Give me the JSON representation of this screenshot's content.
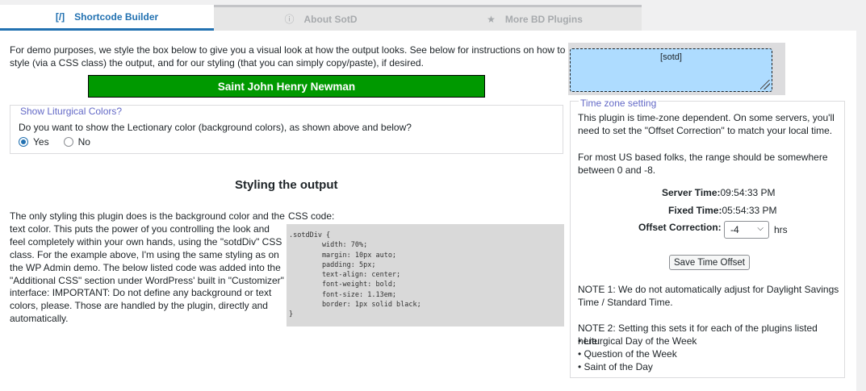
{
  "tabs": [
    {
      "label": "Shortcode Builder",
      "icon": "[/]",
      "active": true
    },
    {
      "label": "About SotD",
      "icon": "ⓘ",
      "active": false
    },
    {
      "label": "More BD Plugins",
      "icon": "★",
      "active": false
    }
  ],
  "intro": "For demo purposes, we style the box below to give you a visual look at how the output looks. See below for instructions on how to style (via a CSS class) the output, and for our styling (that you can simply copy/paste), if desired.",
  "demo_box": {
    "text": "Saint John Henry Newman",
    "bg_color": "#009900"
  },
  "liturgical": {
    "legend": "Show Liturgical Colors?",
    "question": "Do you want to show the Lectionary color (background colors), as shown above and below?",
    "options": [
      "Yes",
      "No"
    ],
    "selected": "Yes"
  },
  "styling": {
    "title": "Styling the output",
    "body": "The only styling this plugin does is the background color and the text color. This puts the power of you controlling the look and feel completely within your own hands, using the \"sotdDiv\" CSS class. For the example above, I'm using the same styling as on the WP Admin demo. The below listed code was added into the \"Additional CSS\" section under WordPress' built in \"Customizer\" interface: IMPORTANT: Do not define any background or text colors, please. Those are handled by the plugin, directly and automatically.",
    "css_label": "CSS code:",
    "css_code": ".sotdDiv {\n        width: 70%;\n        margin: 10px auto;\n        padding: 5px;\n        text-align: center;\n        font-weight: bold;\n        font-size: 1.13em;\n        border: 1px solid black;\n}"
  },
  "shortcode": {
    "value": "[sotd]"
  },
  "timezone": {
    "legend": "Time zone setting",
    "para1": "This plugin is time-zone dependent. On some servers, you'll need to set the \"Offset Correction\" to match your local time.",
    "para2": "For most US based folks, the range should be somewhere between 0 and -8.",
    "server_time_label": "Server Time:",
    "server_time": "09:54:33 PM",
    "fixed_time_label": "Fixed Time:",
    "fixed_time": "05:54:33 PM",
    "offset_label": "Offset Correction:",
    "offset_value": "-4",
    "offset_unit": "hrs",
    "save_label": "Save Time Offset",
    "note1": "NOTE 1: We do not automatically adjust for Daylight Savings Time / Standard Time.",
    "note2": "NOTE 2: Setting this sets it for each of the plugins listed here:",
    "plugins": [
      "• Liturgical Day of the Week",
      "• Question of the Week",
      "• Saint of the Day"
    ]
  }
}
